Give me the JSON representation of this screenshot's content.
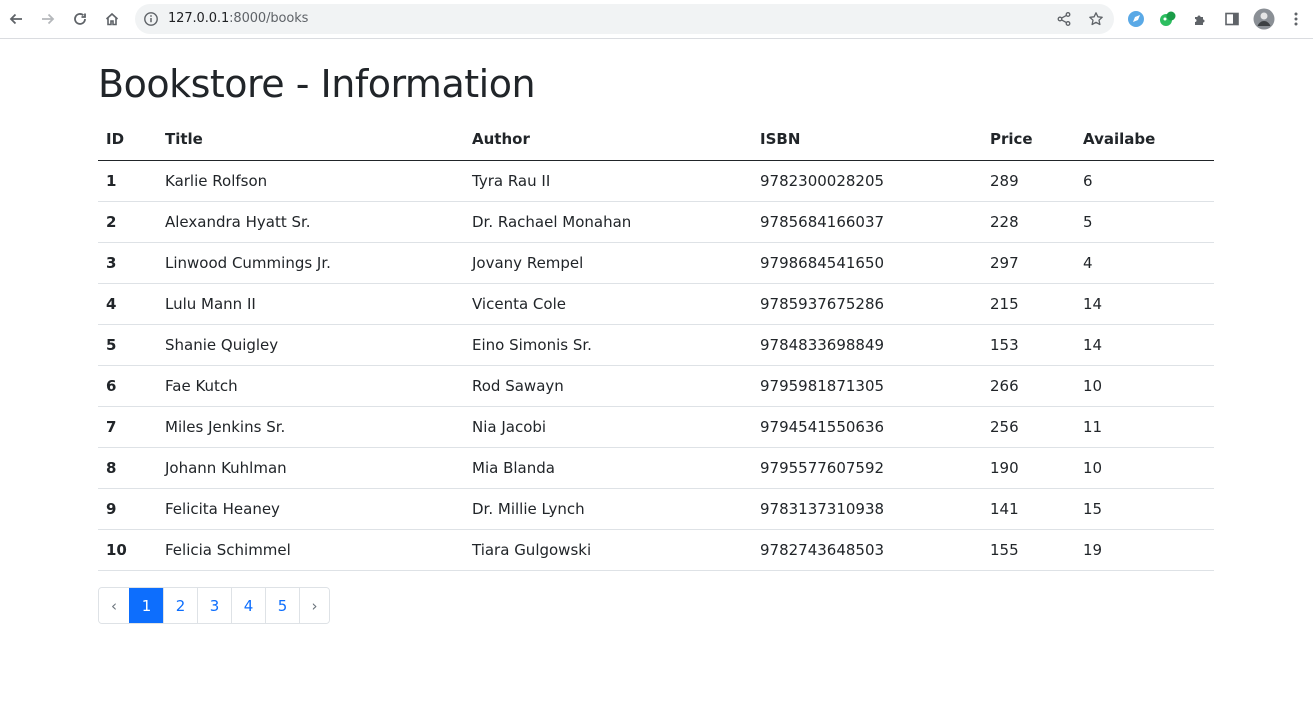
{
  "browser": {
    "url_host": "127.0.0.1",
    "url_path": ":8000/books"
  },
  "page": {
    "title": "Bookstore - Information"
  },
  "table": {
    "headers": [
      "ID",
      "Title",
      "Author",
      "ISBN",
      "Price",
      "Availabe"
    ],
    "rows": [
      [
        "1",
        "Karlie Rolfson",
        "Tyra Rau II",
        "9782300028205",
        "289",
        "6"
      ],
      [
        "2",
        "Alexandra Hyatt Sr.",
        "Dr. Rachael Monahan",
        "9785684166037",
        "228",
        "5"
      ],
      [
        "3",
        "Linwood Cummings Jr.",
        "Jovany Rempel",
        "9798684541650",
        "297",
        "4"
      ],
      [
        "4",
        "Lulu Mann II",
        "Vicenta Cole",
        "9785937675286",
        "215",
        "14"
      ],
      [
        "5",
        "Shanie Quigley",
        "Eino Simonis Sr.",
        "9784833698849",
        "153",
        "14"
      ],
      [
        "6",
        "Fae Kutch",
        "Rod Sawayn",
        "9795981871305",
        "266",
        "10"
      ],
      [
        "7",
        "Miles Jenkins Sr.",
        "Nia Jacobi",
        "9794541550636",
        "256",
        "11"
      ],
      [
        "8",
        "Johann Kuhlman",
        "Mia Blanda",
        "9795577607592",
        "190",
        "10"
      ],
      [
        "9",
        "Felicita Heaney",
        "Dr. Millie Lynch",
        "9783137310938",
        "141",
        "15"
      ],
      [
        "10",
        "Felicia Schimmel",
        "Tiara Gulgowski",
        "9782743648503",
        "155",
        "19"
      ]
    ]
  },
  "pagination": {
    "prev": "‹",
    "next": "›",
    "pages": [
      "1",
      "2",
      "3",
      "4",
      "5"
    ],
    "active_page": "1"
  },
  "colors": {
    "accent": "#0d6efd"
  }
}
